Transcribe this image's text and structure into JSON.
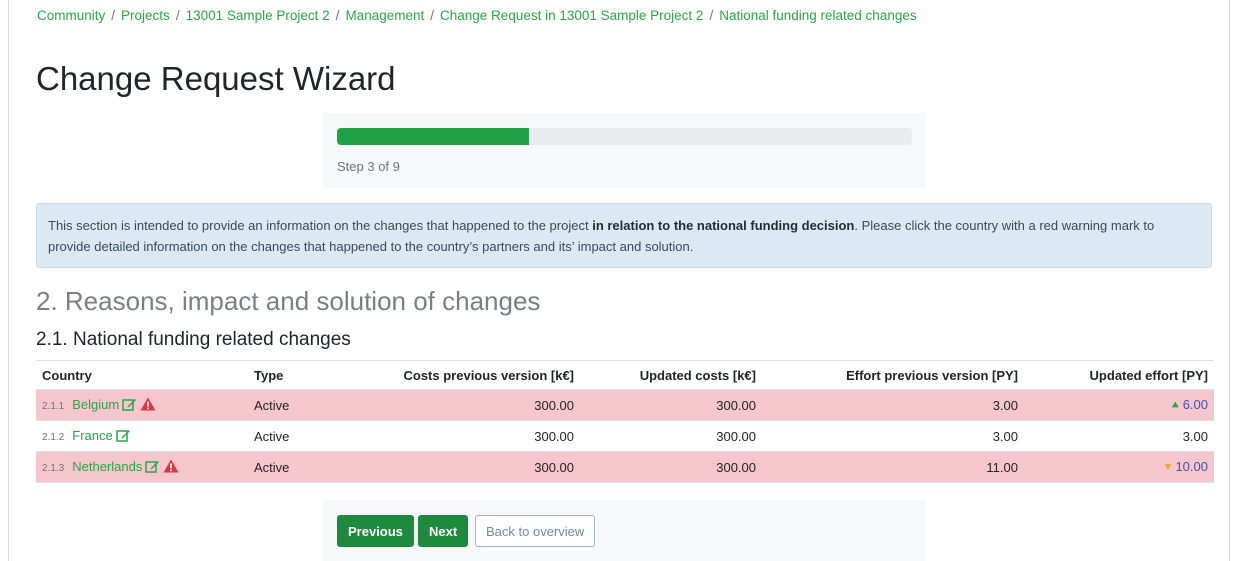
{
  "breadcrumb": [
    {
      "label": "Community"
    },
    {
      "label": "Projects"
    },
    {
      "label": "13001 Sample Project 2"
    },
    {
      "label": "Management"
    },
    {
      "label": "Change Request in 13001 Sample Project 2"
    },
    {
      "label": "National funding related changes"
    }
  ],
  "page_title": "Change Request Wizard",
  "progress": {
    "step_text": "Step 3 of 9",
    "fraction": 0.3333
  },
  "info": {
    "text_1": "This section is intended to provide an information on the changes that happened to the project ",
    "emphasis": "in relation to the national funding decision",
    "text_2": ". Please click the country with a red warning mark to provide detailed information on the changes that happened to the country’s partners and its’ impact and solution."
  },
  "section_title": "2. Reasons, impact and solution of changes",
  "sub_title": "2.1. National funding related changes",
  "table": {
    "headers": {
      "country": "Country",
      "type": "Type",
      "costs_prev": "Costs previous version [k€]",
      "costs_upd": "Updated costs [k€]",
      "effort_prev": "Effort previous version [PY]",
      "effort_upd": "Updated effort [PY]"
    },
    "rows": [
      {
        "index": "2.1.1",
        "country": "Belgium",
        "type": "Active",
        "costs_prev": "300.00",
        "costs_upd": "300.00",
        "effort_prev": "3.00",
        "effort_upd": "6.00",
        "warning": true,
        "trend": "up"
      },
      {
        "index": "2.1.2",
        "country": "France",
        "type": "Active",
        "costs_prev": "300.00",
        "costs_upd": "300.00",
        "effort_prev": "3.00",
        "effort_upd": "3.00",
        "warning": false,
        "trend": "none"
      },
      {
        "index": "2.1.3",
        "country": "Netherlands",
        "type": "Active",
        "costs_prev": "300.00",
        "costs_upd": "300.00",
        "effort_prev": "11.00",
        "effort_upd": "10.00",
        "warning": true,
        "trend": "down"
      }
    ]
  },
  "buttons": {
    "previous": "Previous",
    "next": "Next",
    "back": "Back to overview"
  },
  "colors": {
    "accent_green": "#28a745",
    "warning_row": "#f5c6cb",
    "info_bg": "#dce9f3",
    "danger": "#dc3545"
  },
  "icons": {
    "edit": "edit-icon",
    "warning": "warning-icon",
    "trend_up": "double-chevron-up-icon",
    "trend_down": "double-chevron-down-icon"
  }
}
